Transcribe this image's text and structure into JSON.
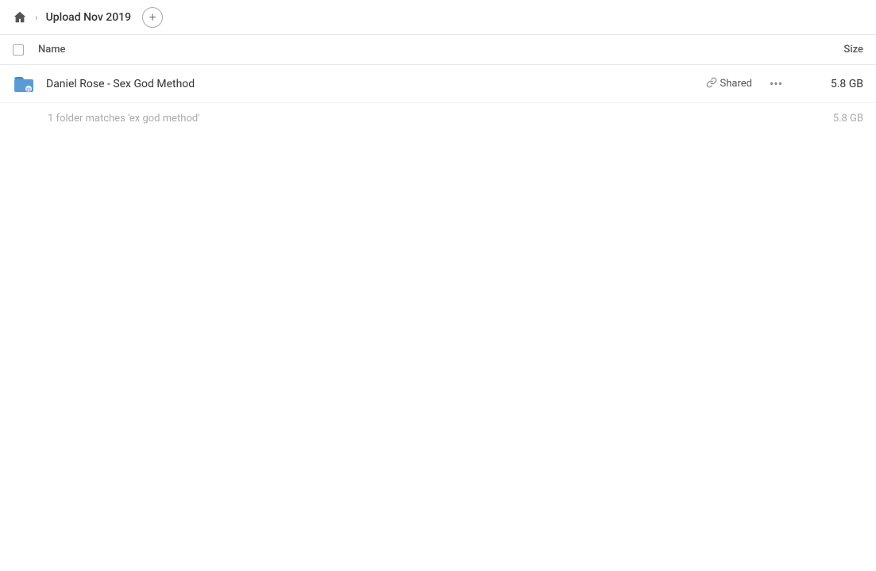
{
  "header": {
    "home_label": "Home",
    "breadcrumb_folder": "Upload Nov 2019",
    "add_button_label": "+"
  },
  "table": {
    "name_column": "Name",
    "size_column": "Size"
  },
  "file_row": {
    "name": "Daniel Rose - Sex God Method",
    "shared_label": "Shared",
    "more_label": "···",
    "size": "5.8 GB"
  },
  "summary": {
    "text": "1 folder matches 'ex god method'",
    "size": "5.8 GB"
  },
  "icons": {
    "home": "home-icon",
    "chevron": "›",
    "link": "🔗",
    "more": "···",
    "add": "+"
  }
}
